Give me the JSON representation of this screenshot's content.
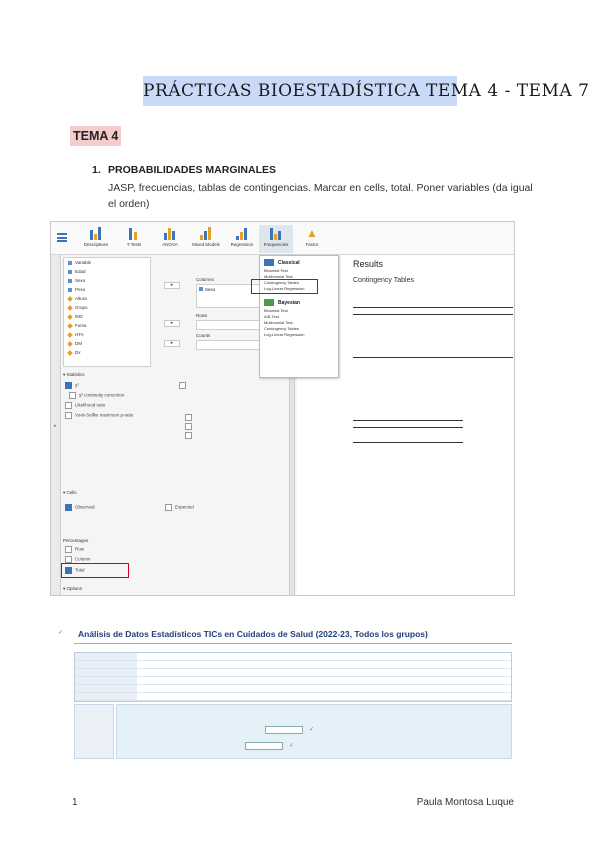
{
  "page_title": "PRÁCTICAS BIOESTADÍSTICA TEMA 4 - TEMA 7",
  "section_heading": "TEMA 4",
  "subsection": {
    "number": "1.",
    "title": "PROBABILIDADES MARGINALES"
  },
  "body_text": "JASP, frecuencias, tablas de contingencias. Marcar en cells, total. Poner variables (da igual el orden)",
  "jasp": {
    "ribbon": [
      "Descriptives",
      "T-Tests",
      "ANOVA",
      "Mixed Models",
      "Regression",
      "Frequencies",
      "Factor"
    ],
    "menu": {
      "classical_label": "Classical",
      "classical_items": [
        "Binomial Test",
        "Multinomial Test",
        "Contingency Tables",
        "Log-Linear Regression"
      ],
      "bayesian_label": "Bayesian",
      "bayesian_items": [
        "Binomial Test",
        "A/B Test",
        "Multinomial Test",
        "Contingency Tables",
        "Log-Linear Regression"
      ]
    },
    "variables": [
      "Variable",
      "Edad",
      "Sexo",
      "Peso",
      "Altura",
      "Grupo",
      "IMC",
      "Fuma",
      "HTA",
      "DM",
      "Dx"
    ],
    "fields": {
      "columns_label": "Columns",
      "columns_value": "Sexo",
      "rows_label": "Rows",
      "counts_label": "Counts"
    },
    "sections": {
      "statistics": "Statistics",
      "cells": "Cells",
      "options": "Options"
    },
    "stat_options": [
      "χ²",
      "χ² continuity correction",
      "Likelihood ratio",
      "Vovk-Sellke maximum p-ratio"
    ],
    "cells_counts": [
      "Observed",
      "Expected"
    ],
    "percentages_label": "Percentages",
    "percentages": [
      "Row",
      "Column",
      "Total"
    ],
    "results": {
      "title": "Results",
      "subtitle": "Contingency Tables"
    }
  },
  "campus": {
    "title": "Análisis de Datos Estadísticos TICs en Cuidados de Salud (2022-23, Todos los grupos)"
  },
  "footer": {
    "page_number": "1",
    "author": "Paula Montosa Luque"
  }
}
